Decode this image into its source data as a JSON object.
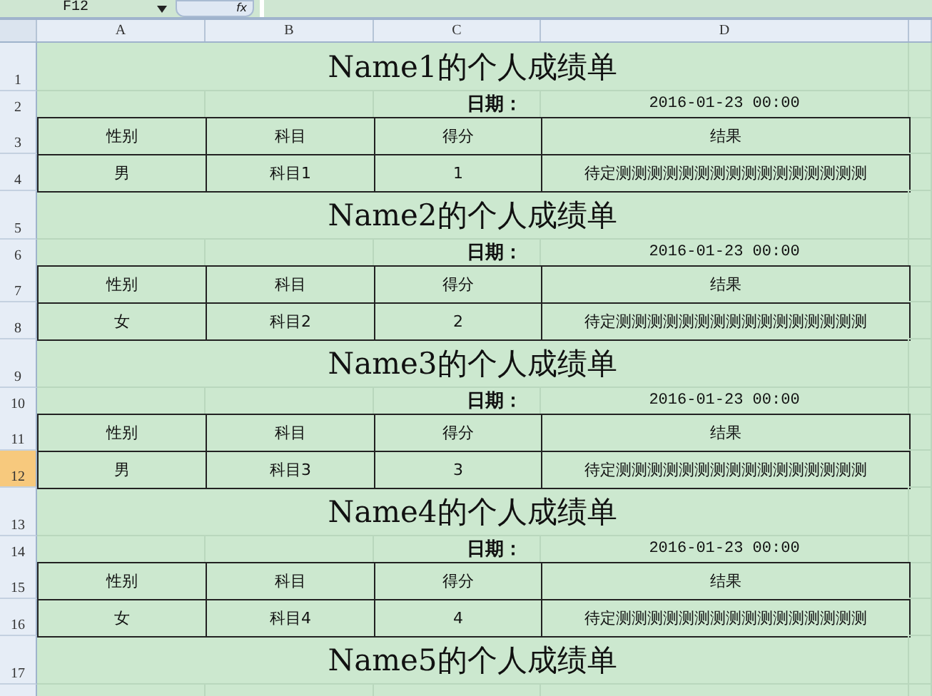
{
  "formula_bar": {
    "name_box": "F12",
    "fx": "fx"
  },
  "columns": [
    "A",
    "B",
    "C",
    "D"
  ],
  "row_headers": [
    {
      "label": "1",
      "selected": false
    },
    {
      "label": "2",
      "selected": false
    },
    {
      "label": "3",
      "selected": false
    },
    {
      "label": "4",
      "selected": false
    },
    {
      "label": "5",
      "selected": false
    },
    {
      "label": "6",
      "selected": false
    },
    {
      "label": "7",
      "selected": false
    },
    {
      "label": "8",
      "selected": false
    },
    {
      "label": "9",
      "selected": false
    },
    {
      "label": "10",
      "selected": false
    },
    {
      "label": "11",
      "selected": false
    },
    {
      "label": "12",
      "selected": true
    },
    {
      "label": "13",
      "selected": false
    },
    {
      "label": "14",
      "selected": false
    },
    {
      "label": "15",
      "selected": false
    },
    {
      "label": "16",
      "selected": false
    },
    {
      "label": "17",
      "selected": false
    }
  ],
  "blocks": [
    {
      "title": "Name1的个人成绩单",
      "date_label": "日期：",
      "date": "2016-01-23 00:00",
      "headers": [
        "性别",
        "科目",
        "得分",
        "结果"
      ],
      "values": [
        "男",
        "科目1",
        "1",
        "待定测测测测测测测测测测测测测测测测"
      ]
    },
    {
      "title": "Name2的个人成绩单",
      "date_label": "日期：",
      "date": "2016-01-23 00:00",
      "headers": [
        "性别",
        "科目",
        "得分",
        "结果"
      ],
      "values": [
        "女",
        "科目2",
        "2",
        "待定测测测测测测测测测测测测测测测测"
      ]
    },
    {
      "title": "Name3的个人成绩单",
      "date_label": "日期：",
      "date": "2016-01-23 00:00",
      "headers": [
        "性别",
        "科目",
        "得分",
        "结果"
      ],
      "values": [
        "男",
        "科目3",
        "3",
        "待定测测测测测测测测测测测测测测测测"
      ]
    },
    {
      "title": "Name4的个人成绩单",
      "date_label": "日期：",
      "date": "2016-01-23 00:00",
      "headers": [
        "性别",
        "科目",
        "得分",
        "结果"
      ],
      "values": [
        "女",
        "科目4",
        "4",
        "待定测测测测测测测测测测测测测测测测"
      ]
    },
    {
      "title": "Name5的个人成绩单"
    }
  ]
}
